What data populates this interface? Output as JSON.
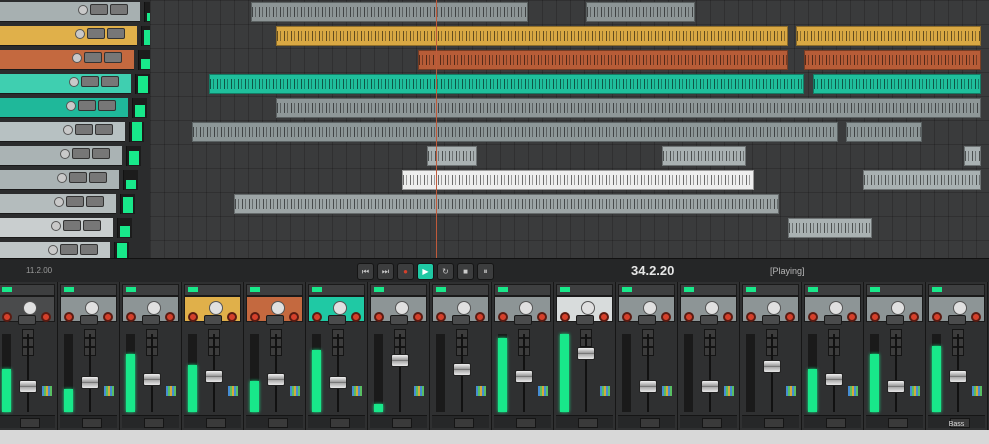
{
  "colors": {
    "meter_green": "#18e88a",
    "record_red": "#d5402b",
    "track_tan": "#e8b04b",
    "track_orange": "#c8643c",
    "track_teal": "#1fc9a4",
    "track_grey": "#9aa3a4",
    "track_white": "#eeeeee"
  },
  "tracks": [
    {
      "label": "",
      "color": "#a7b0b1",
      "route": ""
    },
    {
      "label": "",
      "color": "#e0b04a",
      "route": ""
    },
    {
      "label": "",
      "color": "#c4693f",
      "route": ""
    },
    {
      "label": "",
      "color": "#3fcfb0",
      "route": ""
    },
    {
      "label": "",
      "color": "#1fb89a",
      "route": ""
    },
    {
      "label": "",
      "color": "#b7c1c2",
      "route": ""
    },
    {
      "label": "",
      "color": "#aab3b4",
      "route": ""
    },
    {
      "label": "",
      "color": "#aab3b4",
      "route": ""
    },
    {
      "label": "",
      "color": "#b4bcbd",
      "route": ""
    },
    {
      "label": "",
      "color": "#c9cecf",
      "route": ""
    },
    {
      "label": "",
      "color": "#bfc6c7",
      "route": ""
    },
    {
      "label": "",
      "color": "#b3bbbc",
      "route": ""
    }
  ],
  "items": [
    {
      "track": 0,
      "start": 0.12,
      "end": 0.45,
      "color": "#8d9596"
    },
    {
      "track": 0,
      "start": 0.52,
      "end": 0.65,
      "color": "#8d9596"
    },
    {
      "track": 1,
      "start": 0.15,
      "end": 0.76,
      "color": "#d9a843"
    },
    {
      "track": 1,
      "start": 0.77,
      "end": 0.99,
      "color": "#d9a843"
    },
    {
      "track": 2,
      "start": 0.32,
      "end": 0.76,
      "color": "#b75c37"
    },
    {
      "track": 2,
      "start": 0.78,
      "end": 0.99,
      "color": "#b75c37"
    },
    {
      "track": 3,
      "start": 0.07,
      "end": 0.78,
      "color": "#1fbf9c"
    },
    {
      "track": 3,
      "start": 0.79,
      "end": 0.99,
      "color": "#1fbf9c"
    },
    {
      "track": 4,
      "start": 0.15,
      "end": 0.99,
      "color": "#8e9798"
    },
    {
      "track": 5,
      "start": 0.05,
      "end": 0.82,
      "color": "#8d9798"
    },
    {
      "track": 5,
      "start": 0.83,
      "end": 0.92,
      "color": "#8d9798"
    },
    {
      "track": 6,
      "start": 0.33,
      "end": 0.39,
      "color": "#a9b1b2"
    },
    {
      "track": 6,
      "start": 0.61,
      "end": 0.71,
      "color": "#a9b1b2"
    },
    {
      "track": 6,
      "start": 0.97,
      "end": 0.99,
      "color": "#a9b1b2"
    },
    {
      "track": 7,
      "start": 0.3,
      "end": 0.72,
      "color": "#eeeeee"
    },
    {
      "track": 7,
      "start": 0.85,
      "end": 0.99,
      "color": "#a9b1b2"
    },
    {
      "track": 8,
      "start": 0.1,
      "end": 0.75,
      "color": "#9da5a6"
    },
    {
      "track": 9,
      "start": 0.76,
      "end": 0.86,
      "color": "#a9b1b2"
    }
  ],
  "transport": {
    "left_time": "11.2.00",
    "position": "34.2.20",
    "status": "[Playing]",
    "buttons": [
      {
        "name": "skip-start",
        "glyph": "⏮"
      },
      {
        "name": "skip-end",
        "glyph": "⏭"
      },
      {
        "name": "record",
        "glyph": "●"
      },
      {
        "name": "play",
        "glyph": "▶"
      },
      {
        "name": "loop",
        "glyph": "↻"
      },
      {
        "name": "stop",
        "glyph": "■"
      },
      {
        "name": "pause",
        "glyph": "⏸"
      }
    ]
  },
  "mixer": {
    "strips": [
      {
        "color": "#4a4b4c",
        "meter": 0.55,
        "fader": 0.3,
        "label": ""
      },
      {
        "color": "#8d9596",
        "meter": 0.3,
        "fader": 0.35,
        "label": ""
      },
      {
        "color": "#8d9596",
        "meter": 0.75,
        "fader": 0.4,
        "label": ""
      },
      {
        "color": "#e0b04a",
        "meter": 0.6,
        "fader": 0.45,
        "label": ""
      },
      {
        "color": "#c4693f",
        "meter": 0.4,
        "fader": 0.4,
        "label": ""
      },
      {
        "color": "#1fc9a4",
        "meter": 0.8,
        "fader": 0.35,
        "label": ""
      },
      {
        "color": "#8d9596",
        "meter": 0.1,
        "fader": 0.7,
        "label": ""
      },
      {
        "color": "#8d9596",
        "meter": 0.0,
        "fader": 0.55,
        "label": ""
      },
      {
        "color": "#8d9596",
        "meter": 0.95,
        "fader": 0.45,
        "label": ""
      },
      {
        "color": "#d8dcdc",
        "meter": 1.0,
        "fader": 0.8,
        "label": ""
      },
      {
        "color": "#8d9596",
        "meter": 0.0,
        "fader": 0.3,
        "label": ""
      },
      {
        "color": "#8d9596",
        "meter": 0.0,
        "fader": 0.3,
        "label": ""
      },
      {
        "color": "#8d9596",
        "meter": 0.0,
        "fader": 0.6,
        "label": ""
      },
      {
        "color": "#8d9596",
        "meter": 0.55,
        "fader": 0.4,
        "label": ""
      },
      {
        "color": "#8d9596",
        "meter": 0.75,
        "fader": 0.3,
        "label": ""
      },
      {
        "color": "#8d9596",
        "meter": 0.85,
        "fader": 0.45,
        "label": "Bass"
      }
    ]
  }
}
